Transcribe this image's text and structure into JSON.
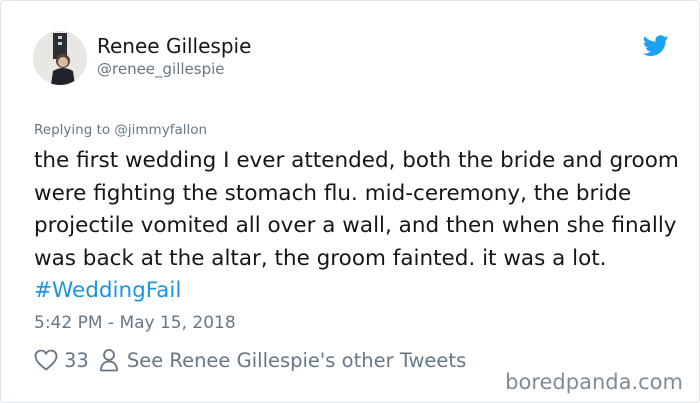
{
  "author": {
    "name": "Renee Gillespie",
    "handle": "@renee_gillespie"
  },
  "reply": {
    "prefix": "Replying to",
    "handle": "@jimmyfallon"
  },
  "tweet": {
    "text": "the first wedding I ever attended, both the bride and groom were fighting the stomach flu. mid-ceremony, the bride projectile vomited all over a wall, and then when she finally was back at the altar, the groom fainted. it was a lot.",
    "hashtag": "#WeddingFail"
  },
  "timestamp": "5:42 PM - May 15, 2018",
  "actions": {
    "like_count": "33",
    "other_tweets_label": "See Renee Gillespie's other Tweets"
  },
  "watermark": "boredpanda.com",
  "icons": {
    "logo": "twitter-bird-icon",
    "like": "heart-icon",
    "profile": "person-icon"
  },
  "colors": {
    "brand": "#1da1f2",
    "link": "#1b95e0",
    "muted": "#657786",
    "text": "#14171a"
  }
}
